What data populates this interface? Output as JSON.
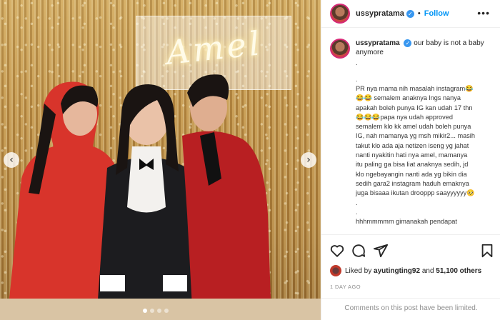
{
  "post": {
    "username": "ussypratama",
    "verified_glyph": "✓",
    "separator": "•",
    "follow_label": "Follow",
    "more_label": "•••",
    "neon_sign": "Amel",
    "nav_prev": "‹",
    "nav_next": "›",
    "carousel_count": 4,
    "carousel_active_index": 0
  },
  "caption": {
    "first_text": "our baby is not a baby anymore",
    "lines": [
      ".",
      ".",
      "PR nya mama nih masalah instagram😂",
      "😂😂 semalem anaknya lngs nanya",
      "apakah boleh punya IG kan udah 17 thn",
      "😂😂😂papa nya udah approved",
      "semalem klo kk amel udah boleh punya",
      "IG, nah mamanya yg msh mikir2... masih",
      "takut klo ada aja netizen iseng yg jahat",
      "nanti nyakitin hati nya amel, mamanya",
      "itu paling ga bisa liat anaknya sedih, jd",
      "klo ngebayangin nanti ada yg bikin dia",
      "sedih gara2 instagram haduh emaknya",
      "juga bisaaa ikutan drooppp saayyyyyy🥺",
      ".",
      ".",
      "hhhmmmmm gimanakah pendapat"
    ]
  },
  "actions": {
    "like_icon": "heart-outline",
    "comment_icon": "comment-bubble",
    "share_icon": "paper-plane",
    "save_icon": "bookmark-outline"
  },
  "likes": {
    "prefix": "Liked by",
    "user": "ayutingting92",
    "joiner": "and",
    "others": "51,100 others"
  },
  "timestamp": "1 DAY AGO",
  "comments_limited": "Comments on this post have been limited.",
  "colors": {
    "accent_blue": "#0095f6",
    "verified_blue": "#3897f0",
    "muted_gray": "#8e8e8e",
    "border": "#efefef"
  }
}
